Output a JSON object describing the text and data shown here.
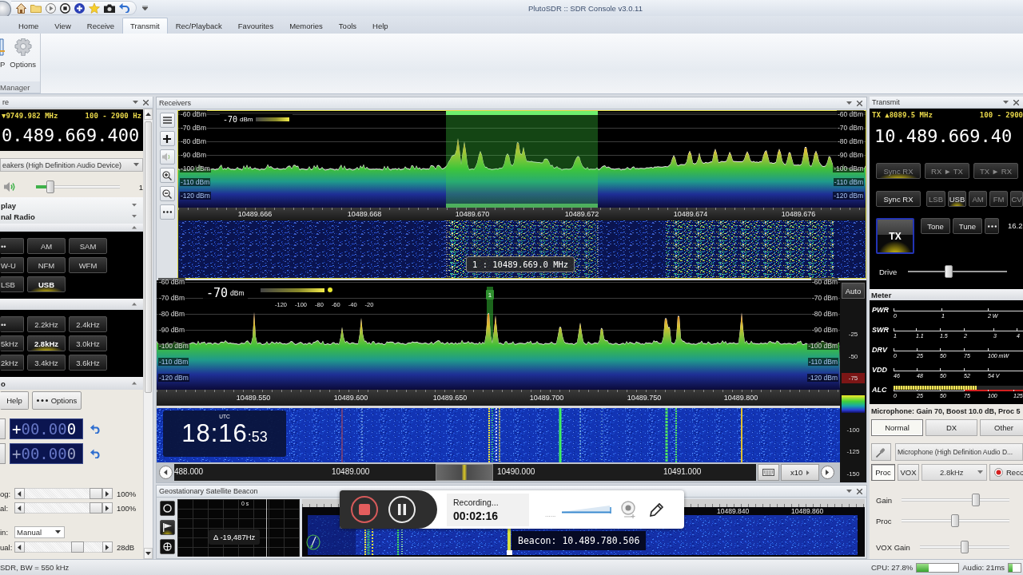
{
  "title_bar": {
    "title": "PlutoSDR :: SDR Console v3.0.11"
  },
  "ribbon": {
    "tabs": [
      {
        "label": "Home",
        "selected": false
      },
      {
        "label": "View",
        "selected": false
      },
      {
        "label": "Receive",
        "selected": false
      },
      {
        "label": "Transmit",
        "selected": true
      },
      {
        "label": "Rec/Playback",
        "selected": false
      },
      {
        "label": "Favourites",
        "selected": false
      },
      {
        "label": "Memories",
        "selected": false
      },
      {
        "label": "Tools",
        "selected": false
      },
      {
        "label": "Help",
        "selected": false
      }
    ],
    "buttons": [
      {
        "label": "P"
      },
      {
        "label": "Options"
      }
    ],
    "group_label": "Manager"
  },
  "receive_panel": {
    "title": "re",
    "vfo": {
      "offset": "▼9749.982 MHz",
      "passband": "100 - 2900 Hz",
      "frequency": "0.489.669.400"
    },
    "audio_device": "eakers (High Definition Audio Device)",
    "volume": {
      "level": 0.14,
      "reading": "1"
    },
    "display_options": [
      "play",
      "nal Radio"
    ],
    "modes": [
      {
        "label": "••",
        "selected": false
      },
      {
        "label": "AM",
        "selected": false
      },
      {
        "label": "SAM",
        "selected": false
      },
      {
        "label": "W-U",
        "selected": false
      },
      {
        "label": "NFM",
        "selected": false
      },
      {
        "label": "WFM",
        "selected": false
      },
      {
        "label": "LSB",
        "selected": false
      },
      {
        "label": "USB",
        "selected": true
      }
    ],
    "bandwidths": [
      {
        "label": "••",
        "selected": false
      },
      {
        "label": "2.2kHz",
        "selected": false
      },
      {
        "label": "2.4kHz",
        "selected": false
      },
      {
        "label": "5kHz",
        "selected": false
      },
      {
        "label": "2.8kHz",
        "selected": true
      },
      {
        "label": "3.0kHz",
        "selected": false
      },
      {
        "label": "2kHz",
        "selected": false
      },
      {
        "label": "3.4kHz",
        "selected": false
      },
      {
        "label": "3.6kHz",
        "selected": false
      }
    ],
    "section_title": "o",
    "buttons": [
      "Help",
      "Options"
    ],
    "offsets": [
      {
        "value": "+00.000",
        "active": true
      },
      {
        "value": "+00.000",
        "active": false
      }
    ],
    "controls": [
      {
        "kind": "slider",
        "label": "og:",
        "level": 1,
        "reading": "100%"
      },
      {
        "kind": "slider",
        "label": "al:",
        "level": 1,
        "reading": "100%"
      },
      {
        "kind": "dropdown",
        "label": "in:",
        "value": "Manual"
      },
      {
        "kind": "slider",
        "label": "ual:",
        "level": 0.72,
        "reading": "28dB"
      }
    ]
  },
  "receivers": {
    "title": "Receivers",
    "overview": {
      "level_reading": "-70",
      "level_unit": "dBm",
      "db_labels_left": [
        "-60 dBm",
        "-70 dBm",
        "-80 dBm",
        "-90 dBm",
        "-100 dBm",
        "-110 dBm",
        "-120 dBm"
      ],
      "db_labels_right": [
        "-60 dBm",
        "-70 dBm",
        "-80 dBm",
        "-90 dBm",
        "-100 dBm",
        "-110 dBm",
        "-120 dBm"
      ],
      "freq_labels": [
        "10489.666",
        "10489.668",
        "10489.670",
        "10489.672",
        "10489.674",
        "10489.676"
      ],
      "tooltip": "1 : 10489.669.0 MHz"
    },
    "main": {
      "level_reading": "-70",
      "level_unit": "dBm",
      "meter_scale": [
        "-120",
        "-100",
        "-80",
        "-60",
        "-40",
        "-20"
      ],
      "db_labels_left": [
        "-60 dBm",
        "-70 dBm",
        "-80 dBm",
        "-90 dBm",
        "-100 dBm",
        "-110 dBm",
        "-120 dBm"
      ],
      "db_labels_right": [
        "-60 dBm",
        "-70 dBm",
        "-80 dBm",
        "-90 dBm",
        "-100 dBm",
        "-110 dBm",
        "-120 dBm"
      ],
      "marker": "1",
      "freq_labels": [
        "10489.550",
        "10489.600",
        "10489.650",
        "10489.700",
        "10489.750",
        "10489.800"
      ]
    },
    "scale": {
      "button": "Auto",
      "labels": [
        "-25",
        "-50",
        "-75",
        "-100",
        "-125",
        "-150"
      ]
    },
    "clock": {
      "zone": "UTC",
      "time": "18:16",
      "seconds": ":53"
    },
    "scroller": {
      "labels": [
        "488.000",
        "10489.000",
        "10490.000",
        "10491.000"
      ],
      "zoom": "x10"
    }
  },
  "beacon": {
    "title": "Geostationary Satellite Beacon",
    "scope_time": "0 s",
    "offset": "Δ -19,487Hz",
    "freq_labels": [
      "10489.840",
      "10489.860"
    ],
    "reading": "Beacon: 10.489.780.506"
  },
  "recorder": {
    "status": "Recording...",
    "elapsed": "00:02:16",
    "dots": "......"
  },
  "transmit": {
    "title": "Transmit",
    "vfo": {
      "offset": "TX ▲8089.5 MHz",
      "passband": "100 - 2900",
      "frequency": "10.489.669.40"
    },
    "sync_buttons": [
      {
        "label": "Sync RX",
        "on": true
      },
      {
        "label": "RX ► TX",
        "on": false
      },
      {
        "label": "TX ► RX",
        "on": false
      }
    ],
    "sync_button": "Sync RX",
    "modes": [
      {
        "label": "LSB",
        "selected": false
      },
      {
        "label": "USB",
        "selected": true
      },
      {
        "label": "AM",
        "selected": false
      },
      {
        "label": "FM",
        "selected": false
      },
      {
        "label": "CV",
        "selected": false
      }
    ],
    "tx_button": {
      "label": "TX",
      "on": true
    },
    "actions": [
      "Tone",
      "Tune"
    ],
    "power": "16.2",
    "drive": {
      "label": "Drive",
      "level": 0.4
    }
  },
  "meter": {
    "title": "Meter",
    "rows": [
      {
        "label": "PWR",
        "scale": [
          "0",
          "1",
          "2 W"
        ]
      },
      {
        "label": "SWR",
        "scale": [
          "1",
          "1.1",
          "1.5",
          "2",
          "3",
          "4"
        ]
      },
      {
        "label": "DRV",
        "scale": [
          "0",
          "25",
          "50",
          "75",
          "100 mW"
        ]
      },
      {
        "label": "VDD",
        "scale": [
          "46",
          "48",
          "50",
          "52",
          "54 V"
        ]
      },
      {
        "label": "ALC",
        "scale": [
          "0",
          "25",
          "50",
          "75",
          "100",
          "125"
        ],
        "level": 0.64
      }
    ]
  },
  "microphone": {
    "summary": "Microphone: Gain 70, Boost 10.0 dB, Proc 5",
    "presets": [
      {
        "label": "Normal",
        "selected": true
      },
      {
        "label": "DX",
        "selected": false
      },
      {
        "label": "Other",
        "selected": false
      }
    ],
    "device": "Microphone (High Definition Audio D...",
    "toggles": [
      {
        "label": "Proc",
        "on": true
      },
      {
        "label": "VOX",
        "on": false
      }
    ],
    "filter": "2.8kHz",
    "record": "Reco",
    "sliders": [
      {
        "label": "Gain",
        "level": 0.7
      },
      {
        "label": "Proc",
        "level": 0.5
      },
      {
        "label": "VOX Gain",
        "level": 0.5
      }
    ]
  },
  "status_bar": {
    "text": "SDR, BW = 550 kHz",
    "cpu": {
      "label": "CPU: 27.8%",
      "level": 0.28
    },
    "audio": {
      "label": "Audio: 21ms",
      "level": 0.3
    }
  }
}
